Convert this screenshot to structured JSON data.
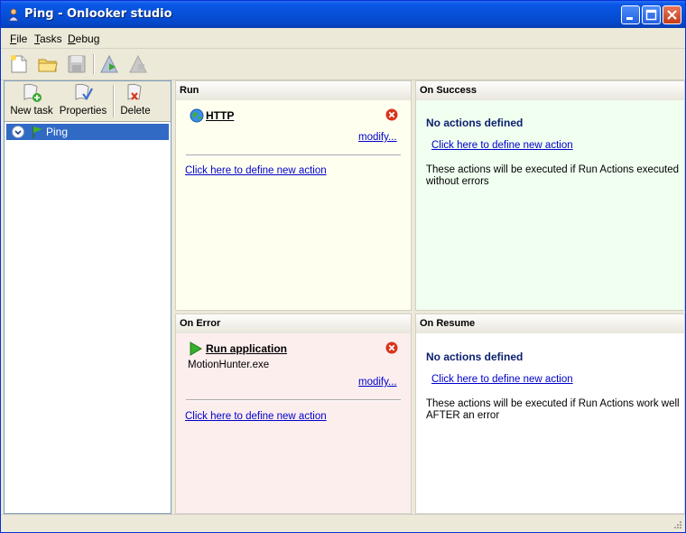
{
  "window": {
    "title": "Ping - Onlooker studio"
  },
  "menu": {
    "items": [
      "File",
      "Tasks",
      "Debug"
    ]
  },
  "toolbar": {
    "icons": [
      "new-document-icon",
      "open-folder-icon",
      "save-icon",
      "run-task-icon",
      "stop-task-icon"
    ]
  },
  "sidebar": {
    "buttons": [
      {
        "label": "New task",
        "icon": "new-task-icon"
      },
      {
        "label": "Properties",
        "icon": "properties-icon"
      },
      {
        "label": "Delete",
        "icon": "delete-icon"
      }
    ],
    "tree": [
      {
        "label": "Ping",
        "icon": "flag-icon"
      }
    ]
  },
  "panels": {
    "run": {
      "header": "Run",
      "action_title": "HTTP",
      "action_icon": "globe-icon",
      "modify": "modify...",
      "define_link": "Click here to define new action",
      "bg": "#fffff0"
    },
    "on_success": {
      "header": "On Success",
      "no_actions": "No actions defined",
      "define_link": "Click here to define new action",
      "description_line1": "These actions will be executed if Run Actions executed",
      "description_line2": "without errors",
      "bg": "#f0fff0"
    },
    "on_error": {
      "header": "On Error",
      "action_title": "Run application",
      "action_icon": "play-icon",
      "action_detail": "MotionHunter.exe",
      "modify": "modify...",
      "define_link": "Click here to define new action",
      "bg": "#fdeeee"
    },
    "on_resume": {
      "header": "On Resume",
      "no_actions": "No actions defined",
      "define_link": "Click here to define new action",
      "description_line1": "These actions will be executed if Run Actions work well",
      "description_line2": "AFTER an error",
      "bg": "#ffffff"
    }
  },
  "colors": {
    "titlebar": "#0650d8",
    "selection": "#316ac5",
    "link": "#0000cc",
    "no_actions_text": "#0a1e6e"
  }
}
